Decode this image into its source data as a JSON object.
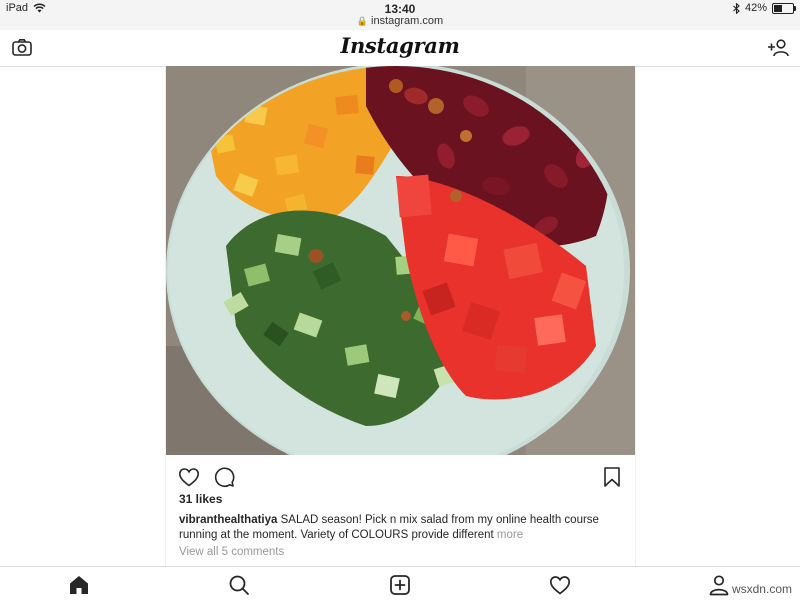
{
  "status_bar": {
    "device": "iPad",
    "time": "13:40",
    "url": "instagram.com",
    "battery_text": "42%",
    "battery_level": 0.42
  },
  "header": {
    "logo": "Instagram",
    "left_icon": "camera-icon",
    "right_icon": "add-person-icon"
  },
  "post": {
    "image_icon": "salad-photo",
    "likes": "31 likes",
    "caption_user": "vibranthealthatiya",
    "caption_text": "SALAD season! Pick n mix salad from my online health course running at the moment. Variety of COLOURS provide different",
    "more_label": "more",
    "view_comments": "View all 5 comments",
    "action_icons": [
      "heart-icon",
      "comment-icon",
      "bookmark-icon"
    ]
  },
  "bottom_nav": {
    "items": [
      "home-icon",
      "search-icon",
      "new-post-icon",
      "activity-icon",
      "profile-icon"
    ]
  },
  "watermark": "wsxdn.com"
}
